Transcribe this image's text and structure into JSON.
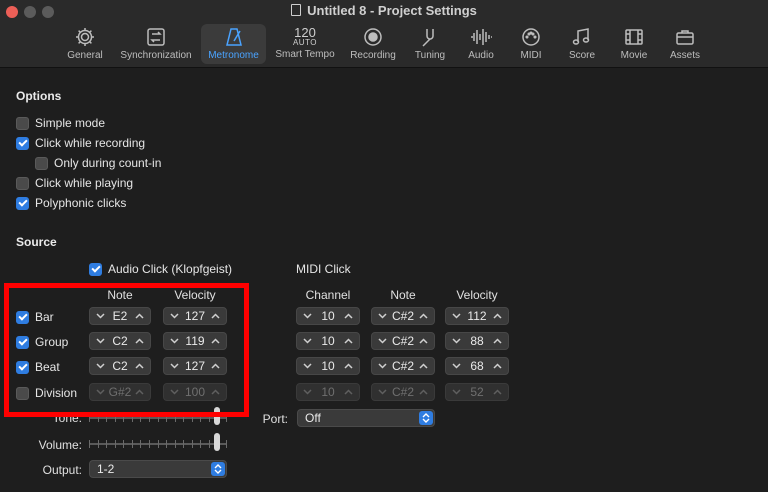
{
  "window": {
    "title": "Untitled 8 - Project Settings"
  },
  "toolbar": [
    {
      "id": "general",
      "label": "General",
      "icon": "gear-icon"
    },
    {
      "id": "sync",
      "label": "Synchronization",
      "icon": "sync-icon"
    },
    {
      "id": "metronome",
      "label": "Metronome",
      "icon": "metronome-icon",
      "active": true
    },
    {
      "id": "smart-tempo",
      "label": "Smart Tempo",
      "icon": "tempo-icon",
      "tempo": "120",
      "auto": "AUTO"
    },
    {
      "id": "recording",
      "label": "Recording",
      "icon": "record-icon"
    },
    {
      "id": "tuning",
      "label": "Tuning",
      "icon": "tuning-fork-icon"
    },
    {
      "id": "audio",
      "label": "Audio",
      "icon": "waveform-icon"
    },
    {
      "id": "midi",
      "label": "MIDI",
      "icon": "midi-port-icon"
    },
    {
      "id": "score",
      "label": "Score",
      "icon": "notes-icon"
    },
    {
      "id": "movie",
      "label": "Movie",
      "icon": "film-icon"
    },
    {
      "id": "assets",
      "label": "Assets",
      "icon": "briefcase-icon"
    }
  ],
  "options": {
    "title": "Options",
    "items": [
      {
        "label": "Simple mode",
        "checked": false
      },
      {
        "label": "Click while recording",
        "checked": true
      },
      {
        "label": "Only during count-in",
        "checked": false
      },
      {
        "label": "Click while playing",
        "checked": false
      },
      {
        "label": "Polyphonic clicks",
        "checked": true
      }
    ]
  },
  "source": {
    "title": "Source",
    "audio_click": {
      "label": "Audio Click (Klopfgeist)",
      "checked": true
    },
    "midi_click": {
      "label": "MIDI Click"
    },
    "headers": {
      "note": "Note",
      "velocity": "Velocity",
      "channel": "Channel",
      "midi_note": "Note",
      "midi_velocity": "Velocity"
    },
    "rows": [
      {
        "label": "Bar",
        "checked": true,
        "note": "E2",
        "velocity": "127",
        "channel": "10",
        "midi_note": "C#2",
        "midi_velocity": "112",
        "disabled": false
      },
      {
        "label": "Group",
        "checked": true,
        "note": "C2",
        "velocity": "119",
        "channel": "10",
        "midi_note": "C#2",
        "midi_velocity": "88",
        "disabled": false
      },
      {
        "label": "Beat",
        "checked": true,
        "note": "C2",
        "velocity": "127",
        "channel": "10",
        "midi_note": "C#2",
        "midi_velocity": "68",
        "disabled": false
      },
      {
        "label": "Division",
        "checked": false,
        "note": "G#2",
        "velocity": "100",
        "channel": "10",
        "midi_note": "C#2",
        "midi_velocity": "52",
        "disabled": true
      }
    ]
  },
  "tone": {
    "label": "Tone:",
    "level": 0.95
  },
  "volume": {
    "label": "Volume:",
    "level": 0.95
  },
  "output": {
    "label": "Output:",
    "value": "1-2"
  },
  "port": {
    "label": "Port:",
    "value": "Off"
  },
  "colors": {
    "accent": "#2f7de1",
    "highlight": "#ff0000",
    "active_tab": "#4aa3ff"
  }
}
